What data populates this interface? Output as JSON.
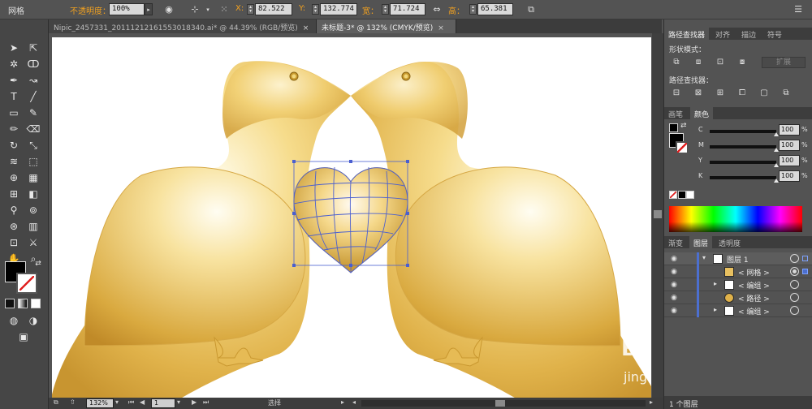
{
  "control_bar": {
    "selection_label": "网格",
    "opacity_label": "不透明度：",
    "opacity_value": "100%",
    "x_label": "X:",
    "x_value": "82.522 ",
    "y_label": "Y:",
    "y_value": "132.774 ",
    "w_label": "宽：",
    "w_value": "71.724 ",
    "h_label": "高：",
    "h_value": "65.381 "
  },
  "tabs": [
    {
      "label": "Nipic_2457331_20111212161553018340.ai* @ 44.39% (RGB/预览)"
    },
    {
      "label": "未标题-3* @ 132% (CMYK/预览)"
    }
  ],
  "status_bar": {
    "zoom": "132%",
    "page": "1",
    "tool": "选择"
  },
  "pathfinder_panel": {
    "tabs": [
      "路径查找器",
      "对齐",
      "描边",
      "符号"
    ],
    "shape_modes_label": "形状模式：",
    "expand_label": "扩展",
    "pathfinders_label": "路径查找器："
  },
  "color_panel": {
    "tabs": [
      "画笔",
      "颜色"
    ],
    "channels": [
      {
        "label": "C",
        "value": "100",
        "unit": "%"
      },
      {
        "label": "M",
        "value": "100",
        "unit": "%"
      },
      {
        "label": "Y",
        "value": "100",
        "unit": "%"
      },
      {
        "label": "K",
        "value": "100",
        "unit": "%"
      }
    ]
  },
  "layers_panel": {
    "tabs": [
      "渐变",
      "图层",
      "透明度"
    ],
    "rows": [
      {
        "name": "图层 1"
      },
      {
        "name": "< 网格 >"
      },
      {
        "name": "< 编组 >"
      },
      {
        "name": "< 路径 >"
      },
      {
        "name": "< 编组 >"
      }
    ],
    "footer": "1 个图层"
  },
  "watermark": {
    "main": "Ba",
    "sub": "jing"
  },
  "colors": {
    "gold_light": "#fff4c6",
    "gold": "#e2b84a",
    "gold_dark": "#b78a22",
    "mesh_line": "#4a5fd0"
  }
}
